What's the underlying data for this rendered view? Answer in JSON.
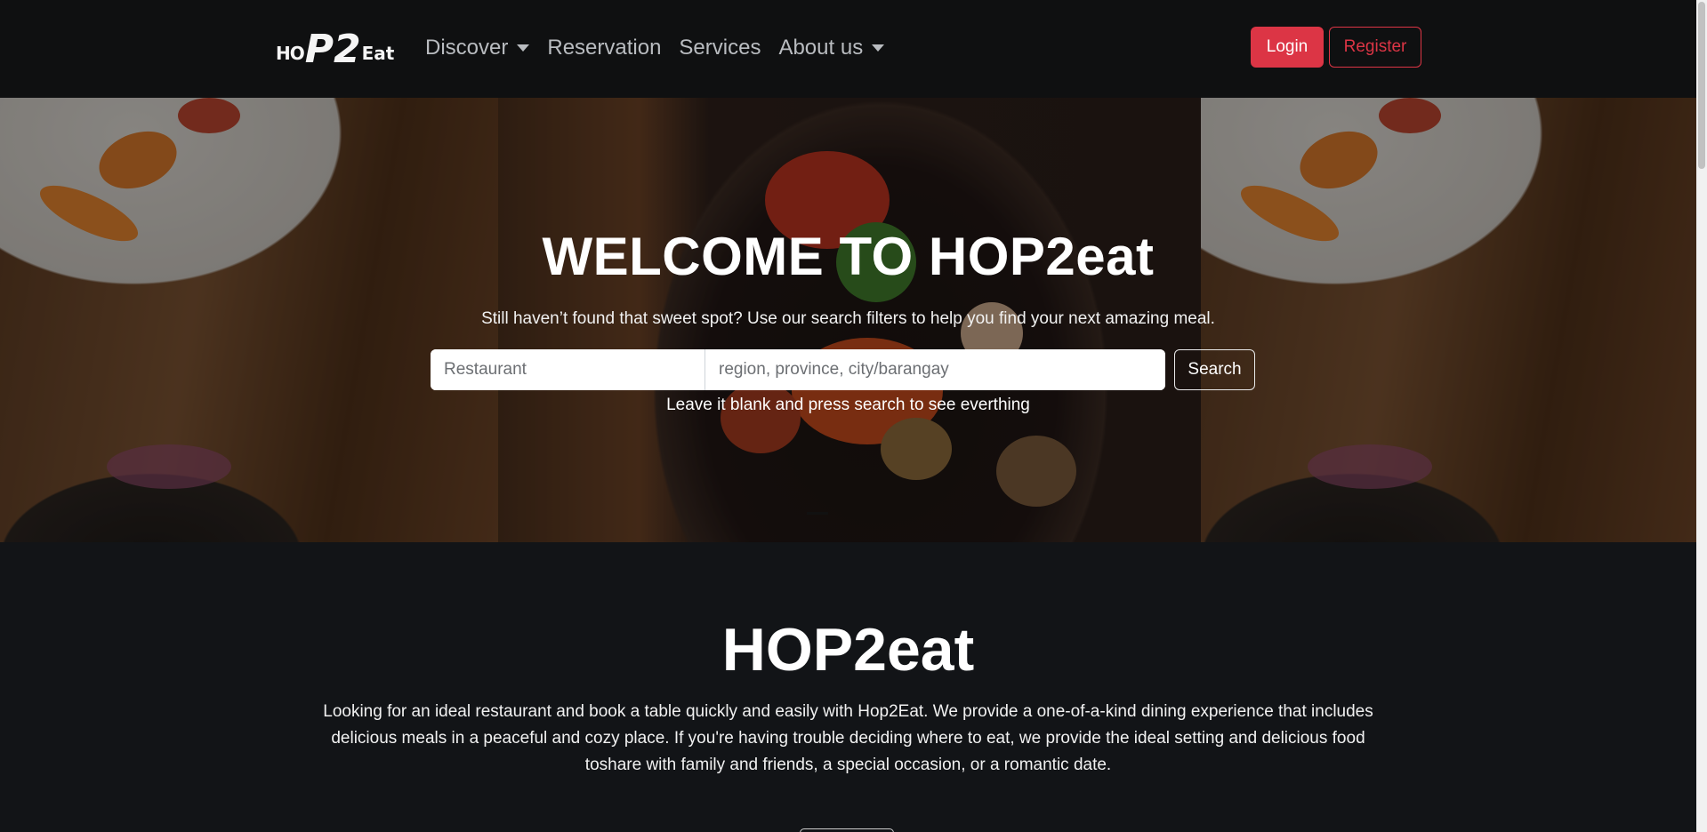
{
  "navbar": {
    "logo": {
      "part1": "HO",
      "part2": "P2",
      "part3": "Eat"
    },
    "items": [
      {
        "label": "Discover",
        "has_dropdown": true
      },
      {
        "label": "Reservation",
        "has_dropdown": false
      },
      {
        "label": "Services",
        "has_dropdown": false
      },
      {
        "label": "About us",
        "has_dropdown": true
      }
    ],
    "login_label": "Login",
    "register_label": "Register"
  },
  "hero": {
    "title": "WELCOME TO HOP2eat",
    "subtitle": "Still haven’t found that sweet spot? Use our search filters to help you find your next amazing meal.",
    "restaurant_placeholder": "Restaurant",
    "location_placeholder": "region, province, city/barangay",
    "search_label": "Search",
    "hint": "Leave it blank and press search to see everthing"
  },
  "about": {
    "title": "HOP2eat",
    "text": "Looking for an ideal restaurant and book a table quickly and easily with Hop2Eat. We provide a one-of-a-kind dining experience that includes delicious meals in a peaceful and cozy place. If you're having trouble deciding where to eat, we provide the ideal setting and delicious food toshare with family and friends, a special occasion, or a romantic date."
  },
  "colors": {
    "accent": "#dc3545",
    "navbar_bg": "#0f1011",
    "page_bg": "#121417"
  }
}
